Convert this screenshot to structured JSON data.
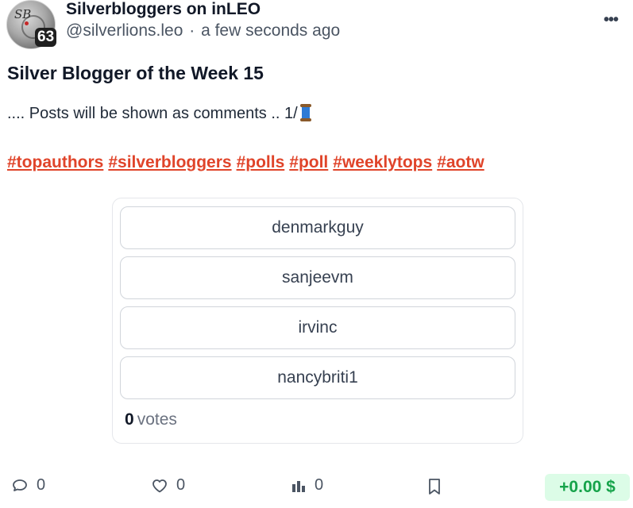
{
  "post": {
    "author_name": "Silverbloggers on inLEO",
    "handle": "@silverlions.leo",
    "separator": "·",
    "timestamp": "a few seconds ago",
    "reputation": "63",
    "avatar_monogram": "SB",
    "more_label": "•••",
    "title": "Silver Blogger of the Week 15",
    "body": ".... Posts will be shown as comments .. 1/",
    "body_emoji": "spool-of-thread",
    "tags": [
      "#topauthors",
      "#silverbloggers",
      "#polls",
      "#poll",
      "#weeklytops",
      "#aotw"
    ]
  },
  "poll": {
    "options": [
      "denmarkguy",
      "sanjeevm",
      "irvinc",
      "nancybriti1"
    ],
    "vote_count": "0",
    "votes_label": "votes"
  },
  "actions": {
    "comments_count": "0",
    "likes_count": "0",
    "stats_count": "0",
    "payout": "+0.00 $"
  },
  "colors": {
    "tag": "#e0442a",
    "payout_text": "#16a34a",
    "payout_bg": "#dcfce7"
  },
  "icons": [
    "comment-icon",
    "heart-icon",
    "bar-chart-icon",
    "bookmark-icon",
    "more-horizontal-icon",
    "spool-of-thread-icon"
  ]
}
